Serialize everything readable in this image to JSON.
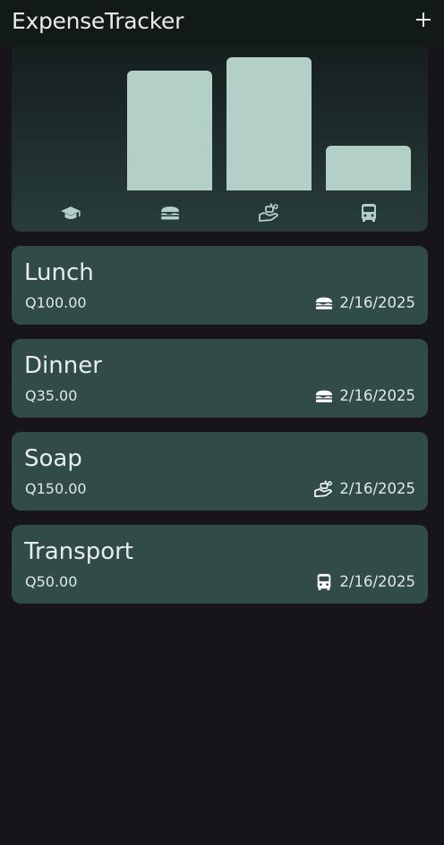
{
  "app": {
    "title": "ExpenseTracker",
    "add_icon": "plus-icon"
  },
  "chart_data": {
    "type": "bar",
    "categories": [
      "education",
      "food",
      "hygiene",
      "transport"
    ],
    "category_icons": [
      "graduation-cap-icon",
      "burger-icon",
      "hand-soap-icon",
      "bus-icon"
    ],
    "values": [
      0,
      135,
      150,
      50
    ],
    "ylim": [
      0,
      150
    ],
    "bar_color": "#b2cfc8"
  },
  "expenses": [
    {
      "title": "Lunch",
      "amount": "Q100.00",
      "date": "2/16/2025",
      "category": "food",
      "icon": "burger-icon"
    },
    {
      "title": "Dinner",
      "amount": "Q35.00",
      "date": "2/16/2025",
      "category": "food",
      "icon": "burger-icon"
    },
    {
      "title": "Soap",
      "amount": "Q150.00",
      "date": "2/16/2025",
      "category": "hygiene",
      "icon": "hand-soap-icon"
    },
    {
      "title": "Transport",
      "amount": "Q50.00",
      "date": "2/16/2025",
      "category": "transport",
      "icon": "bus-icon"
    }
  ],
  "colors": {
    "background": "#17141b",
    "appbar": "#111a19",
    "card": "#314b48",
    "bar": "#b2cfc8"
  }
}
